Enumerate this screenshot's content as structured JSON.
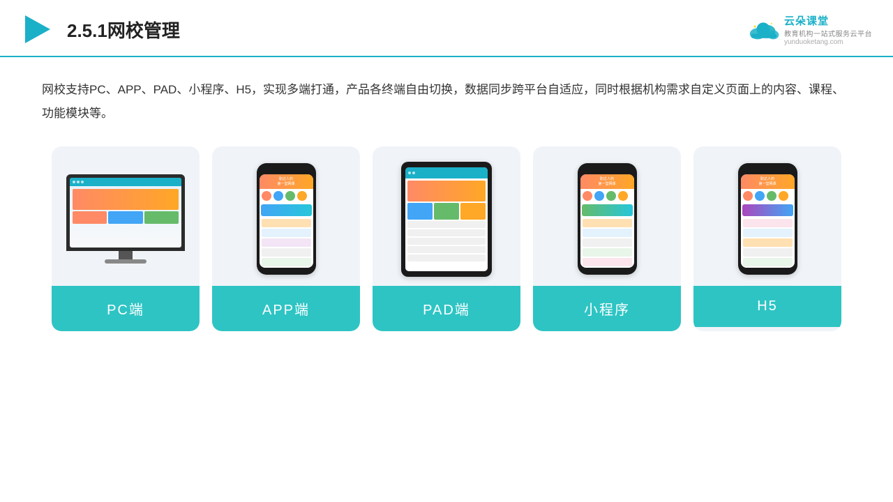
{
  "header": {
    "title": "2.5.1网校管理",
    "logo": {
      "name": "云朵课堂",
      "sub": "教育机构一站式服务云平台",
      "url": "yunduoketang.com"
    }
  },
  "description": "网校支持PC、APP、PAD、小程序、H5，实现多端打通，产品各终端自由切换，数据同步跨平台自适应，同时根据机构需求自定义页面上的内容、课程、功能模块等。",
  "cards": [
    {
      "id": "pc",
      "label": "PC端"
    },
    {
      "id": "app",
      "label": "APP端"
    },
    {
      "id": "pad",
      "label": "PAD端"
    },
    {
      "id": "miniapp",
      "label": "小程序"
    },
    {
      "id": "h5",
      "label": "H5"
    }
  ],
  "colors": {
    "accent": "#2ec4c4",
    "header_border": "#1ab0c8"
  }
}
